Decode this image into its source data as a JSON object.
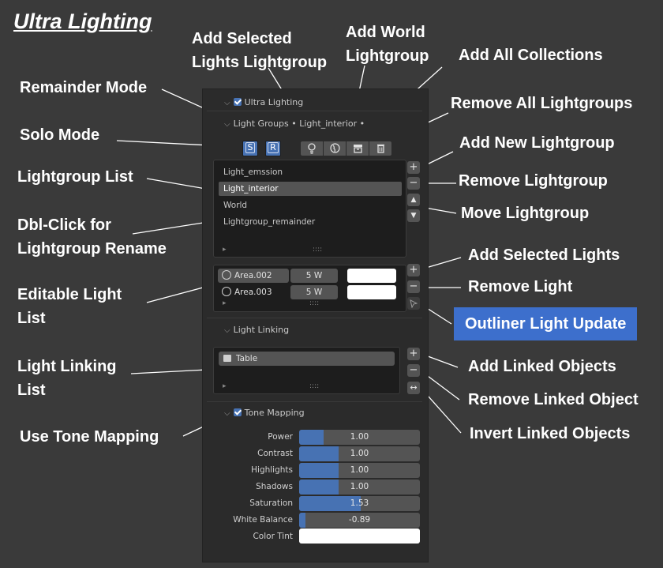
{
  "page_title": "Ultra Lighting",
  "annotations": {
    "add_selected_lights_lightgroup": [
      "Add Selected",
      "Lights Lightgroup"
    ],
    "add_world_lightgroup": [
      "Add World",
      "Lightgroup"
    ],
    "add_all_collections": "Add All Collections",
    "remainder_mode": "Remainder Mode",
    "remove_all_lightgroups": "Remove All Lightgroups",
    "solo_mode": "Solo Mode",
    "add_new_lightgroup": "Add New Lightgroup",
    "lightgroup_list": "Lightgroup List",
    "remove_lightgroup": "Remove Lightgroup",
    "move_lightgroup": "Move Lightgroup",
    "dbl_click_rename": [
      "Dbl-Click for",
      "Lightgroup Rename"
    ],
    "add_selected_lights": "Add Selected Lights",
    "remove_light": "Remove Light",
    "editable_light_list": [
      "Editable Light",
      "List"
    ],
    "outliner_light_update": "Outliner Light Update",
    "light_linking_list": [
      "Light Linking",
      "List"
    ],
    "add_linked_objects": "Add Linked Objects",
    "remove_linked_object": "Remove Linked Object",
    "invert_linked_objects": "Invert Linked Objects",
    "use_tone_mapping": "Use Tone Mapping"
  },
  "panel": {
    "header": "Ultra Lighting",
    "subheader": "Light Groups • Light_interior •",
    "solo_label": "S",
    "remainder_label": "R",
    "icons": [
      "light-bulb-icon",
      "world-globe-icon",
      "collection-box-icon",
      "trash-icon"
    ],
    "lightgroups": [
      {
        "name": "Light_emssion",
        "selected": false
      },
      {
        "name": "Light_interior",
        "selected": true
      },
      {
        "name": "World",
        "selected": false
      },
      {
        "name": "Lightgroup_remainder",
        "selected": false
      }
    ],
    "grip": "::::",
    "lights": [
      {
        "name": "Area.002",
        "power": "5 W",
        "color": "#ffffff"
      },
      {
        "name": "Area.003",
        "power": "5 W",
        "color": "#ffffff"
      }
    ],
    "light_linking_header": "Light Linking",
    "linked_objects": [
      "Table"
    ],
    "tone_mapping_header": "Tone Mapping",
    "tone_mapping_enabled": true,
    "tone_params": [
      {
        "label": "Power",
        "value": "1.00",
        "fill": 0.2
      },
      {
        "label": "Contrast",
        "value": "1.00",
        "fill": 0.33
      },
      {
        "label": "Highlights",
        "value": "1.00",
        "fill": 0.33
      },
      {
        "label": "Shadows",
        "value": "1.00",
        "fill": 0.33
      },
      {
        "label": "Saturation",
        "value": "1.53",
        "fill": 0.51
      },
      {
        "label": "White Balance",
        "value": "-0.89",
        "fill": 0.05
      }
    ],
    "color_tint_label": "Color Tint",
    "color_tint": "#ffffff"
  }
}
